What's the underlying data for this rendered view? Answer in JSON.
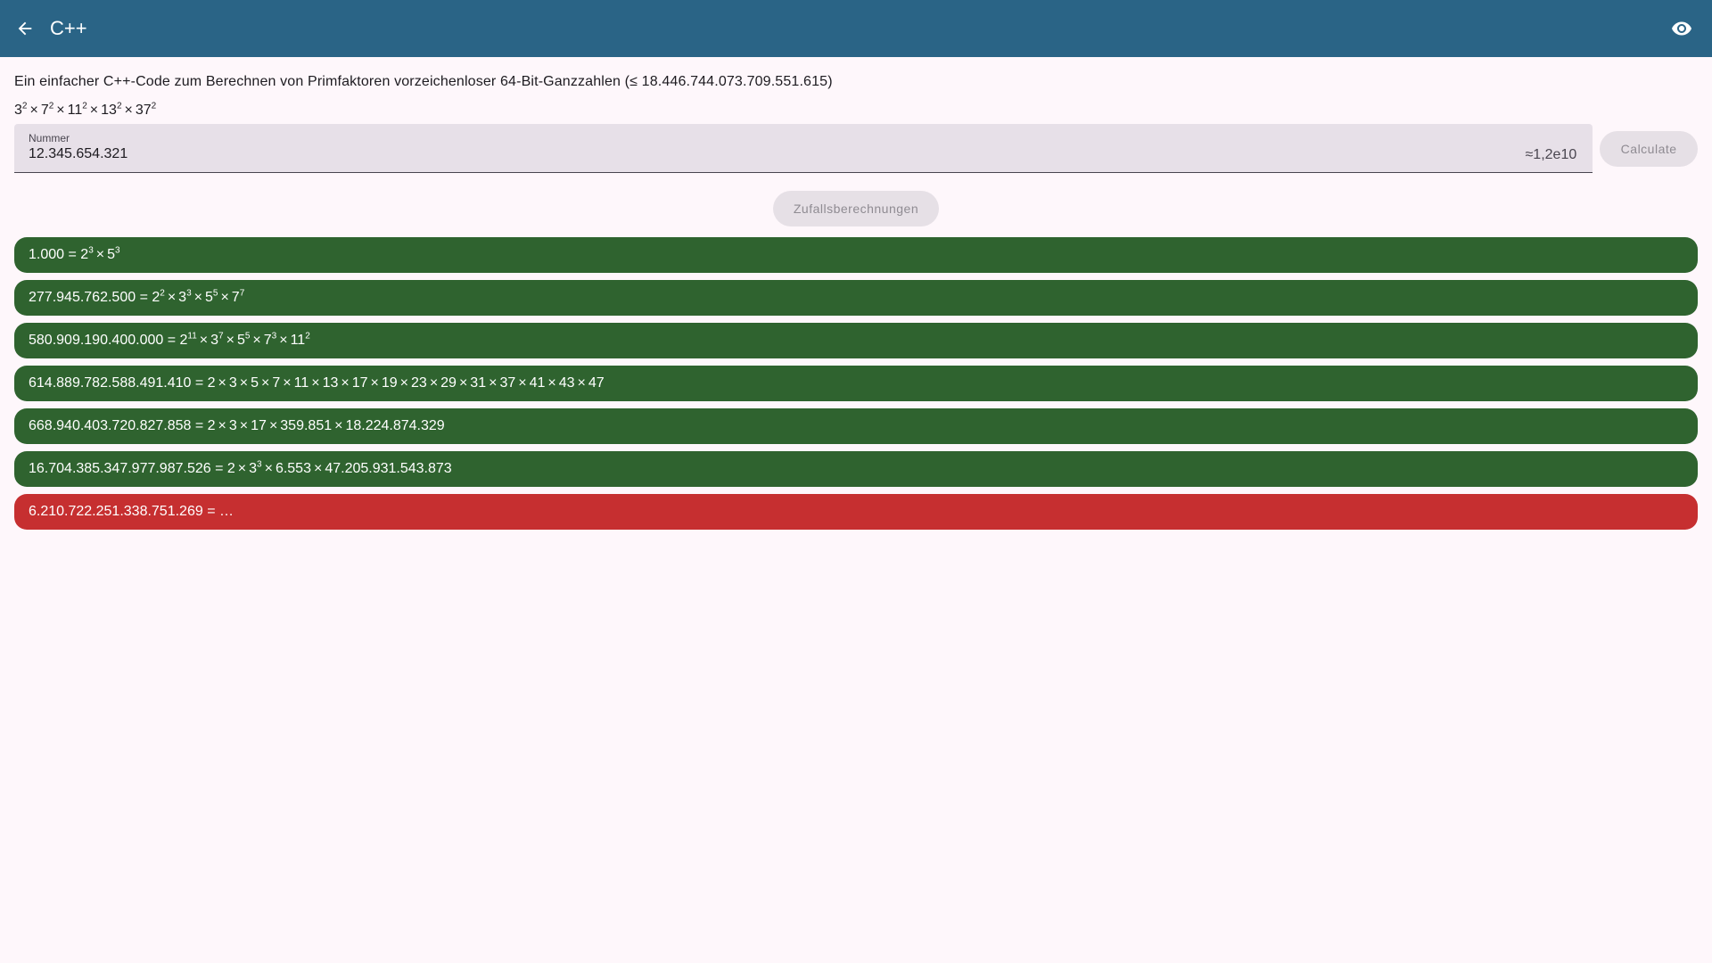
{
  "appbar": {
    "title": "C++",
    "back_icon": "arrow-back-icon",
    "view_icon": "eye-icon"
  },
  "description": "Ein einfacher C++-Code zum Berechnen von Primfaktoren vorzeichenloser 64-Bit-Ganzzahlen (≤ 18.446.744.073.709.551.615)",
  "current_factorization": {
    "factors": [
      {
        "base": "3",
        "exp": "2"
      },
      {
        "base": "7",
        "exp": "2"
      },
      {
        "base": "11",
        "exp": "2"
      },
      {
        "base": "13",
        "exp": "2"
      },
      {
        "base": "37",
        "exp": "2"
      }
    ]
  },
  "input": {
    "label": "Nummer",
    "value": "12.345.654.321",
    "suffix": "≈1,2e10"
  },
  "buttons": {
    "calculate": "Calculate",
    "random": "Zufallsberechnungen"
  },
  "times_symbol": "×",
  "results": [
    {
      "number": "1.000",
      "status": "ok",
      "factors": [
        {
          "base": "2",
          "exp": "3"
        },
        {
          "base": "5",
          "exp": "3"
        }
      ]
    },
    {
      "number": "277.945.762.500",
      "status": "ok",
      "factors": [
        {
          "base": "2",
          "exp": "2"
        },
        {
          "base": "3",
          "exp": "3"
        },
        {
          "base": "5",
          "exp": "5"
        },
        {
          "base": "7",
          "exp": "7"
        }
      ]
    },
    {
      "number": "580.909.190.400.000",
      "status": "ok",
      "factors": [
        {
          "base": "2",
          "exp": "11"
        },
        {
          "base": "3",
          "exp": "7"
        },
        {
          "base": "5",
          "exp": "5"
        },
        {
          "base": "7",
          "exp": "3"
        },
        {
          "base": "11",
          "exp": "2"
        }
      ]
    },
    {
      "number": "614.889.782.588.491.410",
      "status": "ok",
      "factors": [
        {
          "base": "2"
        },
        {
          "base": "3"
        },
        {
          "base": "5"
        },
        {
          "base": "7"
        },
        {
          "base": "11"
        },
        {
          "base": "13"
        },
        {
          "base": "17"
        },
        {
          "base": "19"
        },
        {
          "base": "23"
        },
        {
          "base": "29"
        },
        {
          "base": "31"
        },
        {
          "base": "37"
        },
        {
          "base": "41"
        },
        {
          "base": "43"
        },
        {
          "base": "47"
        }
      ]
    },
    {
      "number": "668.940.403.720.827.858",
      "status": "ok",
      "factors": [
        {
          "base": "2"
        },
        {
          "base": "3"
        },
        {
          "base": "17"
        },
        {
          "base": "359.851"
        },
        {
          "base": "18.224.874.329"
        }
      ]
    },
    {
      "number": "16.704.385.347.977.987.526",
      "status": "ok",
      "factors": [
        {
          "base": "2"
        },
        {
          "base": "3",
          "exp": "3"
        },
        {
          "base": "6.553"
        },
        {
          "base": "47.205.931.543.873"
        }
      ]
    },
    {
      "number": "6.210.722.251.338.751.269",
      "status": "pending",
      "pending_text": "…",
      "factors": []
    }
  ],
  "colors": {
    "appbar": "#2a6486",
    "result_ok": "#2f632f",
    "result_error": "#c62f30",
    "background": "#fef7fb"
  }
}
